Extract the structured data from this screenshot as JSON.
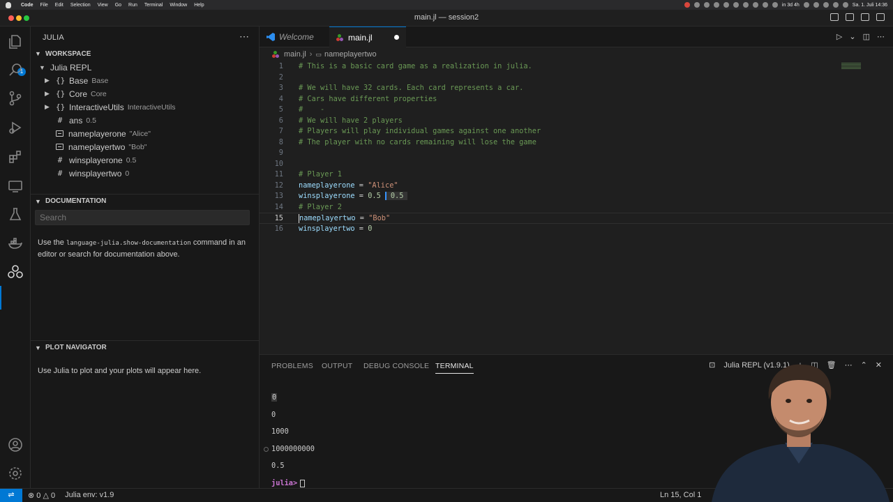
{
  "menubar": {
    "app": "Code",
    "items": [
      "File",
      "Edit",
      "Selection",
      "View",
      "Go",
      "Run",
      "Terminal",
      "Window",
      "Help"
    ],
    "tray_text": "in 3d 4h",
    "clock": "Sa. 1. Juli 14:36"
  },
  "window": {
    "title": "main.jl — session2"
  },
  "activity_bar": {
    "explorer_badge": "1"
  },
  "sidebar": {
    "title": "JULIA",
    "workspace": {
      "header": "WORKSPACE",
      "root": "Julia REPL",
      "items": [
        {
          "name": "Base",
          "value": "Base",
          "kind": "module"
        },
        {
          "name": "Core",
          "value": "Core",
          "kind": "module"
        },
        {
          "name": "InteractiveUtils",
          "value": "InteractiveUtils",
          "kind": "module"
        },
        {
          "name": "ans",
          "value": "0.5",
          "kind": "number"
        },
        {
          "name": "nameplayerone",
          "value": "\"Alice\"",
          "kind": "string"
        },
        {
          "name": "nameplayertwo",
          "value": "\"Bob\"",
          "kind": "string"
        },
        {
          "name": "winsplayerone",
          "value": "0.5",
          "kind": "number"
        },
        {
          "name": "winsplayertwo",
          "value": "0",
          "kind": "number"
        }
      ]
    },
    "documentation": {
      "header": "DOCUMENTATION",
      "search_placeholder": "Search",
      "text_before": "Use the ",
      "command": "language-julia.show-documentation",
      "text_after": " command in an editor or search for documentation above."
    },
    "plot_navigator": {
      "header": "PLOT NAVIGATOR",
      "text": "Use Julia to plot and your plots will appear here."
    }
  },
  "tabs": [
    {
      "label": "Welcome",
      "icon": "vscode-logo-icon"
    },
    {
      "label": "main.jl",
      "icon": "julia-dots-icon",
      "dirty": true
    }
  ],
  "breadcrumb": {
    "file": "main.jl",
    "symbol": "nameplayertwo"
  },
  "editor": {
    "current_line": 15,
    "lines": [
      {
        "n": "1",
        "comment": "# This is a basic card game as a realization in julia."
      },
      {
        "n": "2"
      },
      {
        "n": "3",
        "comment": "# We will have 32 cards. Each card represents a car."
      },
      {
        "n": "4",
        "comment": "# Cars have different properties"
      },
      {
        "n": "5",
        "comment": "#    -"
      },
      {
        "n": "6",
        "comment": "# We will have 2 players"
      },
      {
        "n": "7",
        "comment": "# Players will play individual games against one another"
      },
      {
        "n": "8",
        "comment": "# The player with no cards remaining will lose the game"
      },
      {
        "n": "9"
      },
      {
        "n": "10"
      },
      {
        "n": "11",
        "comment": "# Player 1"
      },
      {
        "n": "12",
        "var": "nameplayerone",
        "op": " = ",
        "str": "\"Alice\""
      },
      {
        "n": "13",
        "var": "winsplayerone",
        "op": " = ",
        "num": "0.5",
        "result": "0.5"
      },
      {
        "n": "14",
        "comment": "# Player 2"
      },
      {
        "n": "15",
        "var": "nameplayertwo",
        "op": " = ",
        "str": "\"Bob\""
      },
      {
        "n": "16",
        "var": "winsplayertwo",
        "op": " = ",
        "num": "0"
      }
    ]
  },
  "panel": {
    "tabs": [
      "PROBLEMS",
      "OUTPUT",
      "DEBUG CONSOLE",
      "TERMINAL"
    ],
    "active_tab": "TERMINAL",
    "terminal_name": "Julia REPL (v1.9.1)",
    "output": [
      "0",
      "0",
      "1000",
      "1000000000",
      "0.5"
    ],
    "prompt": "julia>"
  },
  "statusbar": {
    "errors": "0",
    "warnings": "0",
    "julia_env": "Julia env: v1.9",
    "position": "Ln 15, Col 1"
  },
  "colors": {
    "accent": "#0078d4",
    "comment": "#6a9955",
    "string": "#ce9178",
    "number": "#b5cea8",
    "variable": "#9cdcfe",
    "julia_prompt": "#cb75d3"
  }
}
